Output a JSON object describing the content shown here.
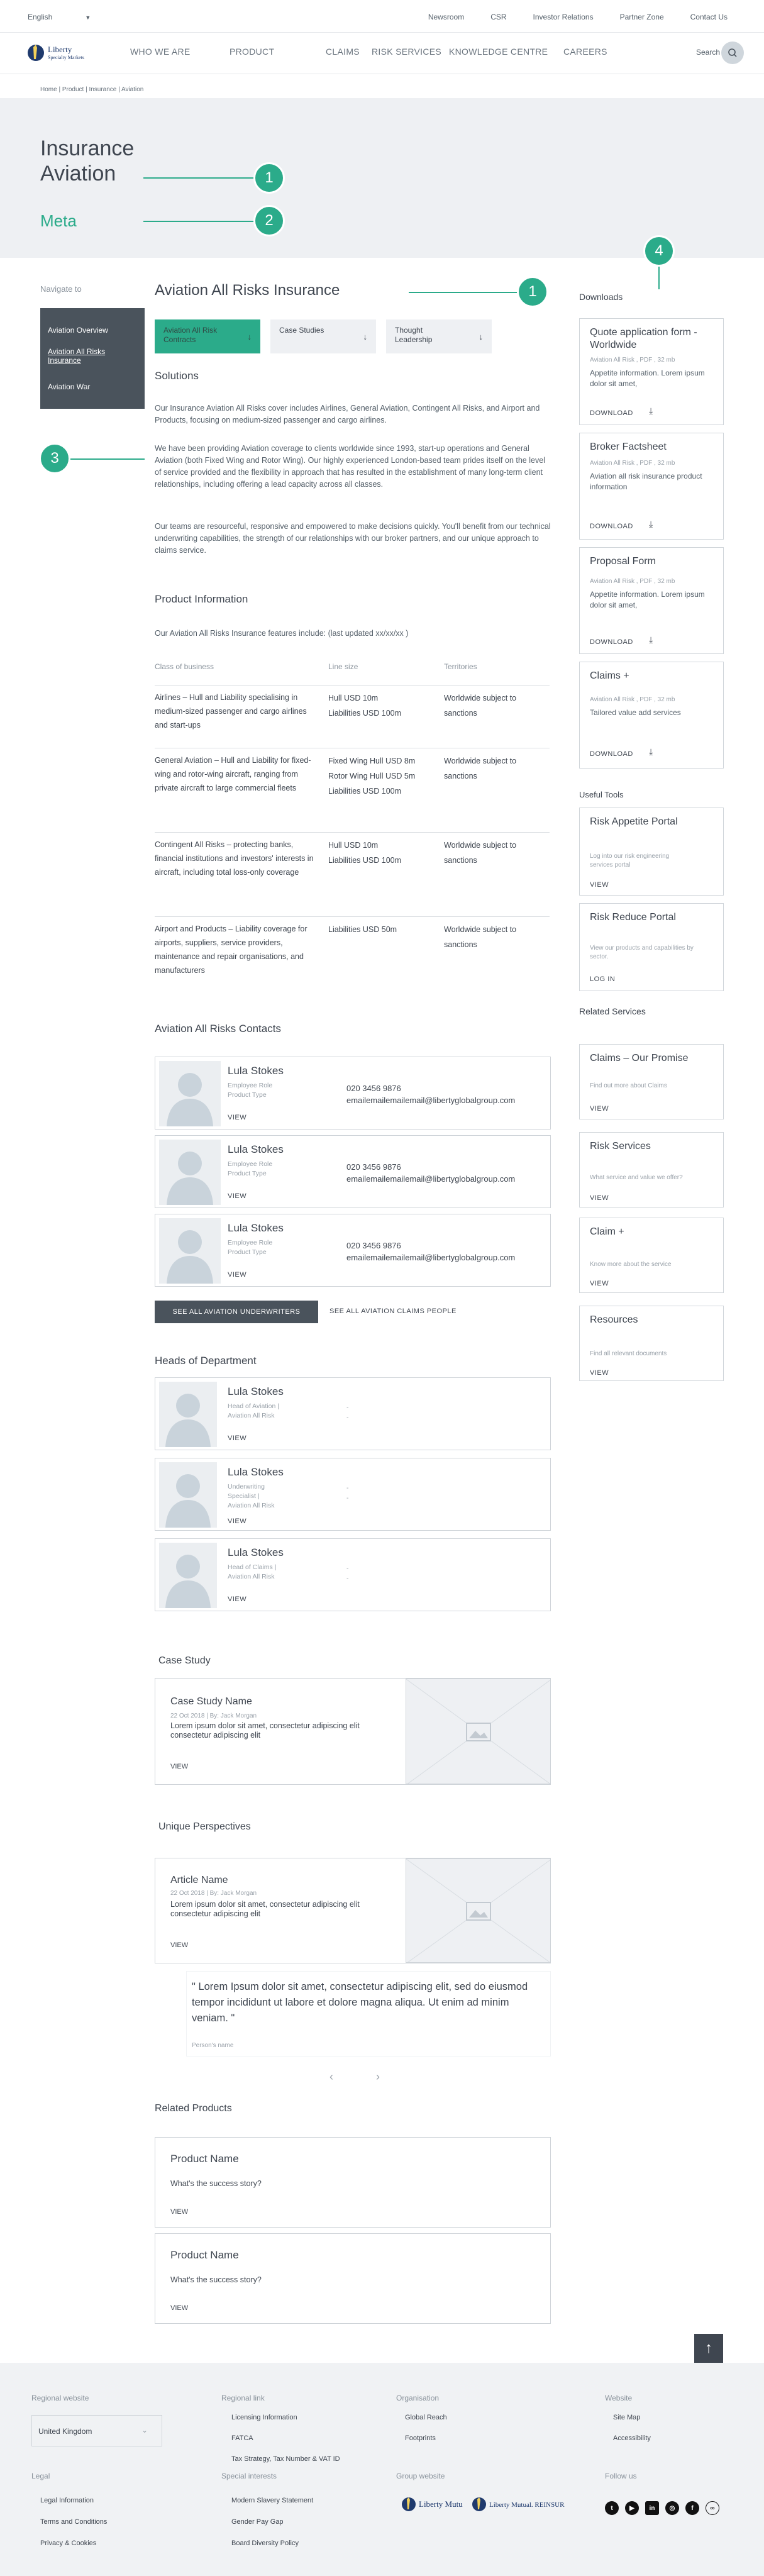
{
  "utility_bar": {
    "language": "English",
    "links": [
      "Newsroom",
      "CSR",
      "Investor Relations",
      "Partner Zone",
      "Contact Us"
    ]
  },
  "brand": {
    "name": "Liberty",
    "sub": "Specialty Markets"
  },
  "nav": {
    "items": [
      "WHO WE ARE",
      "PRODUCT",
      "CLAIMS",
      "RISK SERVICES",
      "KNOWLEDGE CENTRE",
      "CAREERS"
    ],
    "search_label": "Search"
  },
  "breadcrumb": "Home | Product | Insurance | Aviation",
  "hero": {
    "title": "Insurance Aviation",
    "meta": "Meta"
  },
  "callouts": [
    "1",
    "2",
    "1",
    "3",
    "4"
  ],
  "left_nav": {
    "title": "Navigate to",
    "items": [
      "Aviation Overview",
      "Aviation All Risks Insurance",
      "Aviation War"
    ]
  },
  "main": {
    "title": "Aviation All Risks Insurance",
    "tabs": [
      "Aviation All Risk Contracts",
      "Case Studies",
      "Thought Leadership"
    ],
    "tab_arrow": "↓",
    "solutions_heading": "Solutions",
    "paragraphs": [
      "Our Insurance Aviation All Risks cover includes Airlines, General Aviation, Contingent All Risks, and Airport and Products, focusing on medium-sized passenger and cargo airlines.",
      "We have been providing Aviation coverage to clients worldwide since 1993, start-up operations and General Aviation (both Fixed Wing and Rotor Wing). Our highly experienced London-based team prides itself on the level of service provided and the flexibility in approach that has resulted in the establishment of many long-term client relationships, including offering a lead capacity across all classes.",
      "Our teams are resourceful, responsive and empowered to make decisions quickly. You'll benefit from our technical underwriting capabilities, the strength of our relationships with our broker partners, and our unique approach to claims service."
    ],
    "product_info_heading": "Product Information",
    "product_info_intro": "Our Aviation All Risks Insurance features include: (last updated xx/xx/xx )",
    "table": {
      "headers": [
        "Class of business",
        "Line size",
        "Territories"
      ],
      "rows": [
        [
          "Airlines – Hull and Liability specialising in medium-sized passenger and cargo airlines and start-ups",
          "Hull USD 10m\nLiabilities USD 100m",
          "Worldwide subject to sanctions"
        ],
        [
          "General Aviation – Hull and Liability for fixed-wing and rotor-wing aircraft, ranging from private aircraft to large commercial fleets",
          "Fixed Wing Hull USD 8m\nRotor Wing Hull USD 5m\nLiabilities USD 100m",
          "Worldwide subject to sanctions"
        ],
        [
          "Contingent All Risks – protecting banks, financial institutions and investors' interests in aircraft, including total loss-only coverage",
          "Hull USD 10m\nLiabilities USD 100m",
          "Worldwide subject to sanctions"
        ],
        [
          "Airport and Products – Liability coverage for airports, suppliers, service providers, maintenance and repair organisations, and manufacturers",
          "Liabilities USD 50m",
          "Worldwide subject to sanctions"
        ]
      ]
    },
    "contacts_heading": "Aviation All Risks Contacts",
    "contacts": [
      {
        "name": "Lula Stokes",
        "role1": "Employee Role",
        "role2": "Product Type",
        "phone": "020 3456 9876",
        "email": "emailemailemailemail@libertyglobalgroup.com",
        "view": "VIEW"
      },
      {
        "name": "Lula Stokes",
        "role1": "Employee Role",
        "role2": "Product Type",
        "phone": "020 3456 9876",
        "email": "emailemailemailemail@libertyglobalgroup.com",
        "view": "VIEW"
      },
      {
        "name": "Lula Stokes",
        "role1": "Employee Role",
        "role2": "Product Type",
        "phone": "020 3456 9876",
        "email": "emailemailemailemail@libertyglobalgroup.com",
        "view": "VIEW"
      }
    ],
    "btn_underwriters": "SEE ALL AVIATION UNDERWRITERS",
    "btn_claims": "SEE ALL AVIATION CLAIMS PEOPLE",
    "heads_heading": "Heads of Department",
    "heads": [
      {
        "name": "Lula Stokes",
        "role": "Head of Aviation | Aviation All Risk",
        "view": "VIEW"
      },
      {
        "name": "Lula Stokes",
        "role": "Underwriting Specialist | Aviation All Risk",
        "view": "VIEW"
      },
      {
        "name": "Lula Stokes",
        "role": "Head of Claims | Aviation All Risk",
        "view": "VIEW"
      }
    ],
    "case_study_heading": "Case Study",
    "case_study": {
      "title": "Case Study Name",
      "meta": "22 Oct 2018 | By: Jack Morgan",
      "body": "Lorem ipsum dolor sit amet, consectetur adipiscing elit consectetur adipiscing elit",
      "view": "VIEW"
    },
    "perspectives_heading": "Unique Perspectives",
    "article": {
      "title": "Article Name",
      "meta": "22 Oct 2018 | By: Jack Morgan",
      "body": "Lorem ipsum dolor sit amet, consectetur adipiscing elit consectetur adipiscing elit",
      "view": "VIEW"
    },
    "quote": "\" Lorem Ipsum dolor sit amet, consectetur adipiscing elit, sed do eiusmod tempor incididunt ut labore et dolore magna aliqua. Ut enim ad minim veniam. \"",
    "quote_name": "Person's name",
    "carousel_prev": "‹",
    "carousel_next": "›",
    "related_products_heading": "Related Products",
    "related_products": [
      {
        "title": "Product Name",
        "text": "What's the success story?",
        "view": "VIEW"
      },
      {
        "title": "Product Name",
        "text": "What's the success story?",
        "view": "VIEW"
      }
    ]
  },
  "sidebar": {
    "downloads_heading": "Downloads",
    "downloads": [
      {
        "title": "Quote application form - Worldwide",
        "meta": "Aviation All Risk , PDF , 32 mb",
        "desc": "Appetite information. Lorem ipsum dolor sit amet,",
        "action": "DOWNLOAD"
      },
      {
        "title": "Broker Factsheet",
        "meta": "Aviation All Risk , PDF , 32 mb",
        "desc": "Aviation all risk insurance product information",
        "action": "DOWNLOAD"
      },
      {
        "title": "Proposal Form",
        "meta": "Aviation All Risk , PDF , 32 mb",
        "desc": "Appetite information. Lorem ipsum dolor sit amet,",
        "action": "DOWNLOAD"
      },
      {
        "title": "Claims +",
        "meta": "Aviation All Risk , PDF , 32 mb",
        "desc": "Tailored value add services",
        "action": "DOWNLOAD"
      }
    ],
    "tools_heading": "Useful Tools",
    "tools": [
      {
        "title": "Risk Appetite Portal",
        "desc": "Log into our risk engineering services portal",
        "action": "VIEW"
      },
      {
        "title": "Risk Reduce Portal",
        "desc": "View our products and capabilities by sector.",
        "action": "LOG IN"
      }
    ],
    "services_heading": "Related Services",
    "services": [
      {
        "title": "Claims – Our Promise",
        "desc": "Find out more about Claims",
        "action": "VIEW"
      },
      {
        "title": "Risk Services",
        "desc": "What service and value we offer?",
        "action": "VIEW"
      },
      {
        "title": "Claim +",
        "desc": "Know more about the service",
        "action": "VIEW"
      },
      {
        "title": "Resources",
        "desc": "Find all relevant documents",
        "action": "VIEW"
      }
    ]
  },
  "back_to_top": "↑",
  "footer": {
    "regional_heading": "Regional website",
    "region_value": "United Kingdom",
    "regional_link_heading": "Regional link",
    "regional_links": [
      "Licensing Information",
      "FATCA",
      "Tax Strategy, Tax Number & VAT ID"
    ],
    "organisation_heading": "Organisation",
    "organisation_links": [
      "Global Reach",
      "Footprints"
    ],
    "website_heading": "Website",
    "website_links": [
      "Site Map",
      "Accessibility"
    ],
    "legal_heading": "Legal",
    "legal_links": [
      "Legal Information",
      "Terms and Conditions",
      "Privacy & Cookies"
    ],
    "special_heading": "Special interests",
    "special_links": [
      "Modern Slavery Statement",
      "Gender Pay Gap",
      "Board Diversity Policy"
    ],
    "group_heading": "Group website",
    "group_logos": [
      "Liberty Mutual.",
      "Liberty Mutual. REINSURANCE"
    ],
    "follow_heading": "Follow us",
    "social": [
      "twitter-icon",
      "youtube-icon",
      "linkedin-icon",
      "instagram-icon",
      "facebook-icon",
      "link-icon"
    ]
  },
  "colors": {
    "accent": "#2bab8a",
    "dark": "#4a535c",
    "hero_bg": "#eef0f3",
    "footer_bg": "#f0f2f4"
  }
}
